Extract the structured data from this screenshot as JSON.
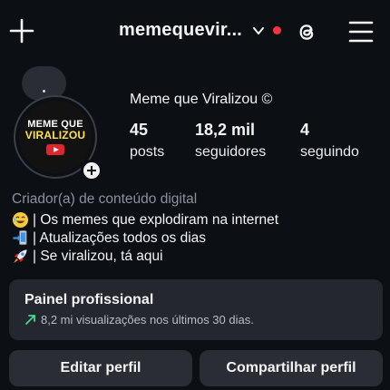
{
  "header": {
    "username": "memequevir...",
    "icons": {
      "new_post": "plus-icon",
      "switch_account": "chevron-down-icon",
      "notification": "notification-dot",
      "threads": "threads-icon",
      "menu": "menu-icon"
    }
  },
  "profile": {
    "display_name": "Meme que Viralizou ©",
    "avatar": {
      "line1": "MEME QUE",
      "line2": "VIRALIZOU"
    },
    "stats": [
      {
        "value": "45",
        "label": "posts"
      },
      {
        "value": "18,2 mil",
        "label": "seguidores"
      },
      {
        "value": "4",
        "label": "seguindo"
      }
    ],
    "category": "Criador(a) de conteúdo digital",
    "bio": [
      {
        "icon": "laughing-emoji-icon",
        "text": "| Os memes que explodiram na internet"
      },
      {
        "icon": "phone-update-emoji-icon",
        "text": "| Atualizações todos os dias"
      },
      {
        "icon": "rocket-emoji-icon",
        "text": "| Se viralizou, tá aqui"
      }
    ]
  },
  "dashboard": {
    "title": "Painel profissional",
    "subtitle": "8,2 mi visualizações nos últimos 30 dias.",
    "trend_icon": "trending-up-icon",
    "accent": "#3ddc97"
  },
  "actions": {
    "edit": "Editar perfil",
    "share": "Compartilhar perfil"
  },
  "colors": {
    "background": "#0c0f14",
    "card": "#24272d",
    "notification": "#ff3040",
    "logo_yellow": "#ffe14a"
  }
}
